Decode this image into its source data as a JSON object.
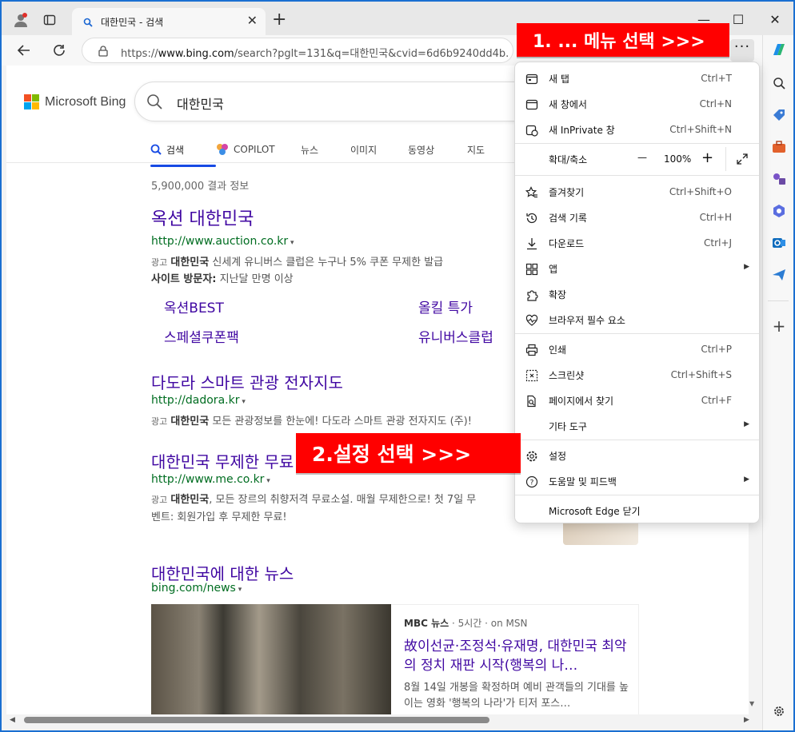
{
  "tab": {
    "title": "대한민국 - 검색"
  },
  "address": {
    "url_prefix": "https://",
    "url_host": "www.bing.com",
    "url_rest": "/search?pglt=131&q=대한민국&cvid=6d6b9240dd4b..."
  },
  "bing": {
    "logo_text": "Microsoft Bing",
    "query": "대한민국",
    "tabs": [
      "검색",
      "COPILOT",
      "뉴스",
      "이미지",
      "동영상",
      "지도"
    ],
    "result_count": "5,900,000 결과 정보",
    "results": [
      {
        "title": "옥션 대한민국",
        "url": "http://www.auction.co.kr",
        "ad": "광고",
        "desc_bold": "대한민국",
        "desc": " 신세계 유니버스 클럽은 누구나 5% 쿠폰 무제한 발급",
        "visitors_label": "사이트 방문자:",
        "visitors": " 지난달 만명 이상",
        "sitelinks": [
          "옥션BEST",
          "올킬 특가",
          "스페셜쿠폰팩",
          "유니버스클럽"
        ]
      },
      {
        "title": "다도라 스마트 관광 전자지도",
        "url": "http://dadora.kr",
        "ad": "광고",
        "desc_bold": "대한민국",
        "desc": " 모든 관광정보를 한눈에! 다도라 스마트 관광 전자지도 (주)!"
      },
      {
        "title": "대한민국 무제한 무료",
        "url": "http://www.me.co.kr",
        "ad": "광고",
        "desc_bold": "대한민국",
        "desc": ", 모든 장르의 취향저격 무료소설. 매월 무제한으로! 첫 7일 무",
        "desc2": "벤트: 회원가입 후 무제한 무료!"
      }
    ],
    "news": {
      "title": "대한민국에 대한 뉴스",
      "source_url": "bing.com/news",
      "publisher": "MBC 뉴스",
      "meta": "· 5시간 · on MSN",
      "headline": "故이선균·조정석·유재명, 대한민국 최악의 정치 재판 시작(행복의 나…",
      "snippet": "8월 14일 개봉을 확정하며 예비 관객들의 기대를 높이는 영화 '행복의 나라'가 티저 포스…"
    }
  },
  "menu": {
    "items": [
      {
        "label": "새 탭",
        "shortcut": "Ctrl+T",
        "icon": "new-tab-icon"
      },
      {
        "label": "새 창에서",
        "shortcut": "Ctrl+N",
        "icon": "new-window-icon"
      },
      {
        "label": "새 InPrivate 창",
        "shortcut": "Ctrl+Shift+N",
        "icon": "inprivate-icon"
      },
      {
        "label": "즐겨찾기",
        "shortcut": "Ctrl+Shift+O",
        "icon": "favorites-icon"
      },
      {
        "label": "검색 기록",
        "shortcut": "Ctrl+H",
        "icon": "history-icon"
      },
      {
        "label": "다운로드",
        "shortcut": "Ctrl+J",
        "icon": "download-icon"
      },
      {
        "label": "앱",
        "shortcut": "",
        "icon": "apps-icon"
      },
      {
        "label": "확장",
        "shortcut": "",
        "icon": "extensions-icon"
      },
      {
        "label": "브라우저 필수 요소",
        "shortcut": "",
        "icon": "heartbeat-icon"
      },
      {
        "label": "인쇄",
        "shortcut": "Ctrl+P",
        "icon": "print-icon"
      },
      {
        "label": "스크린샷",
        "shortcut": "Ctrl+Shift+S",
        "icon": "screenshot-icon"
      },
      {
        "label": "페이지에서 찾기",
        "shortcut": "Ctrl+F",
        "icon": "find-icon"
      },
      {
        "label": "기타 도구",
        "shortcut": "",
        "icon": ""
      },
      {
        "label": "설정",
        "shortcut": "",
        "icon": "gear-icon"
      },
      {
        "label": "도움말 및 피드백",
        "shortcut": "",
        "icon": "help-icon"
      },
      {
        "label": "Microsoft Edge 닫기",
        "shortcut": "",
        "icon": ""
      }
    ],
    "zoom_label": "확대/축소",
    "zoom_minus": "—",
    "zoom_value": "100%",
    "zoom_plus": "+"
  },
  "callouts": {
    "step1": "1. ... 메뉴 선택 >>>",
    "step2": "2.설정 선택 >>>"
  },
  "colors": {
    "accent": "#174ae4",
    "link": "#4007a2",
    "url": "#006d21",
    "callout": "#ff0000"
  }
}
